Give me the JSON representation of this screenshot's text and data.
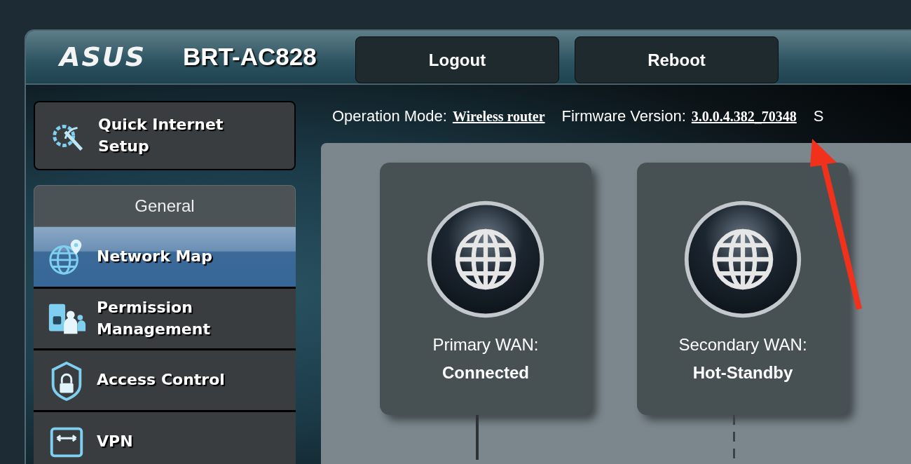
{
  "header": {
    "logo": "ASUS",
    "model": "BRT-AC828",
    "buttons": [
      "Logout",
      "Reboot"
    ]
  },
  "quick_setup": {
    "label": "Quick Internet Setup"
  },
  "sidebar": {
    "section": "General",
    "items": [
      {
        "label": "Network Map",
        "selected": true,
        "kind": "map"
      },
      {
        "label": "Permission Management",
        "selected": false,
        "kind": "permission"
      },
      {
        "label": "Access Control",
        "selected": false,
        "kind": "access"
      },
      {
        "label": "VPN",
        "selected": false,
        "kind": "vpn"
      }
    ]
  },
  "info": [
    {
      "label": "Operation Mode:",
      "value": "Wireless router"
    },
    {
      "label": "Firmware Version:",
      "value": "3.0.0.4.382_70348"
    },
    {
      "label": "S"
    }
  ],
  "wan_cards": [
    {
      "label": "Primary WAN:",
      "status": "Connected",
      "kind": "solid"
    },
    {
      "label": "Secondary WAN:",
      "status": "Hot-Standby",
      "kind": "dashed"
    }
  ]
}
